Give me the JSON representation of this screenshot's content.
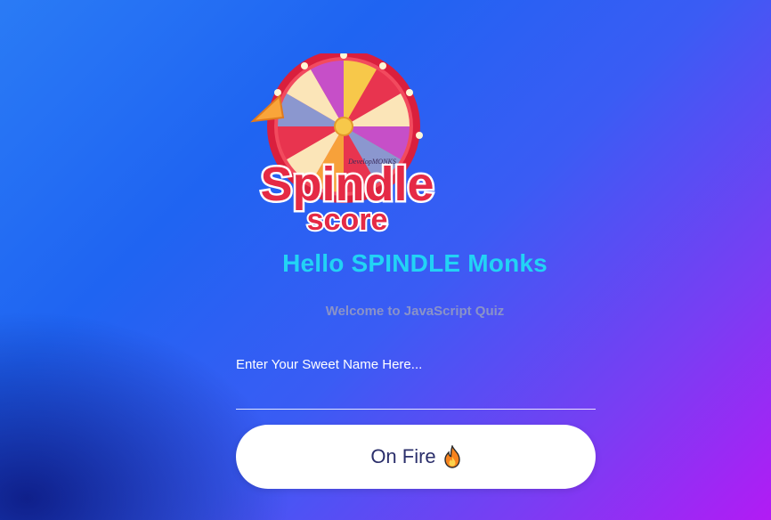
{
  "logo": {
    "word1": "Spindle",
    "word2": "score",
    "brand": "DevelopMONKS"
  },
  "greeting": "Hello SPINDLE Monks",
  "subtitle": "Welcome to JavaScript Quiz",
  "name_input": {
    "placeholder": "Enter Your Sweet Name Here...",
    "value": ""
  },
  "start_button": {
    "label": "On Fire",
    "icon": "fire-icon"
  },
  "colors": {
    "greeting": "#22d3f5",
    "subtitle": "#8a93c8",
    "button_text": "#2b2f6b",
    "logo_red": "#e52a45"
  }
}
